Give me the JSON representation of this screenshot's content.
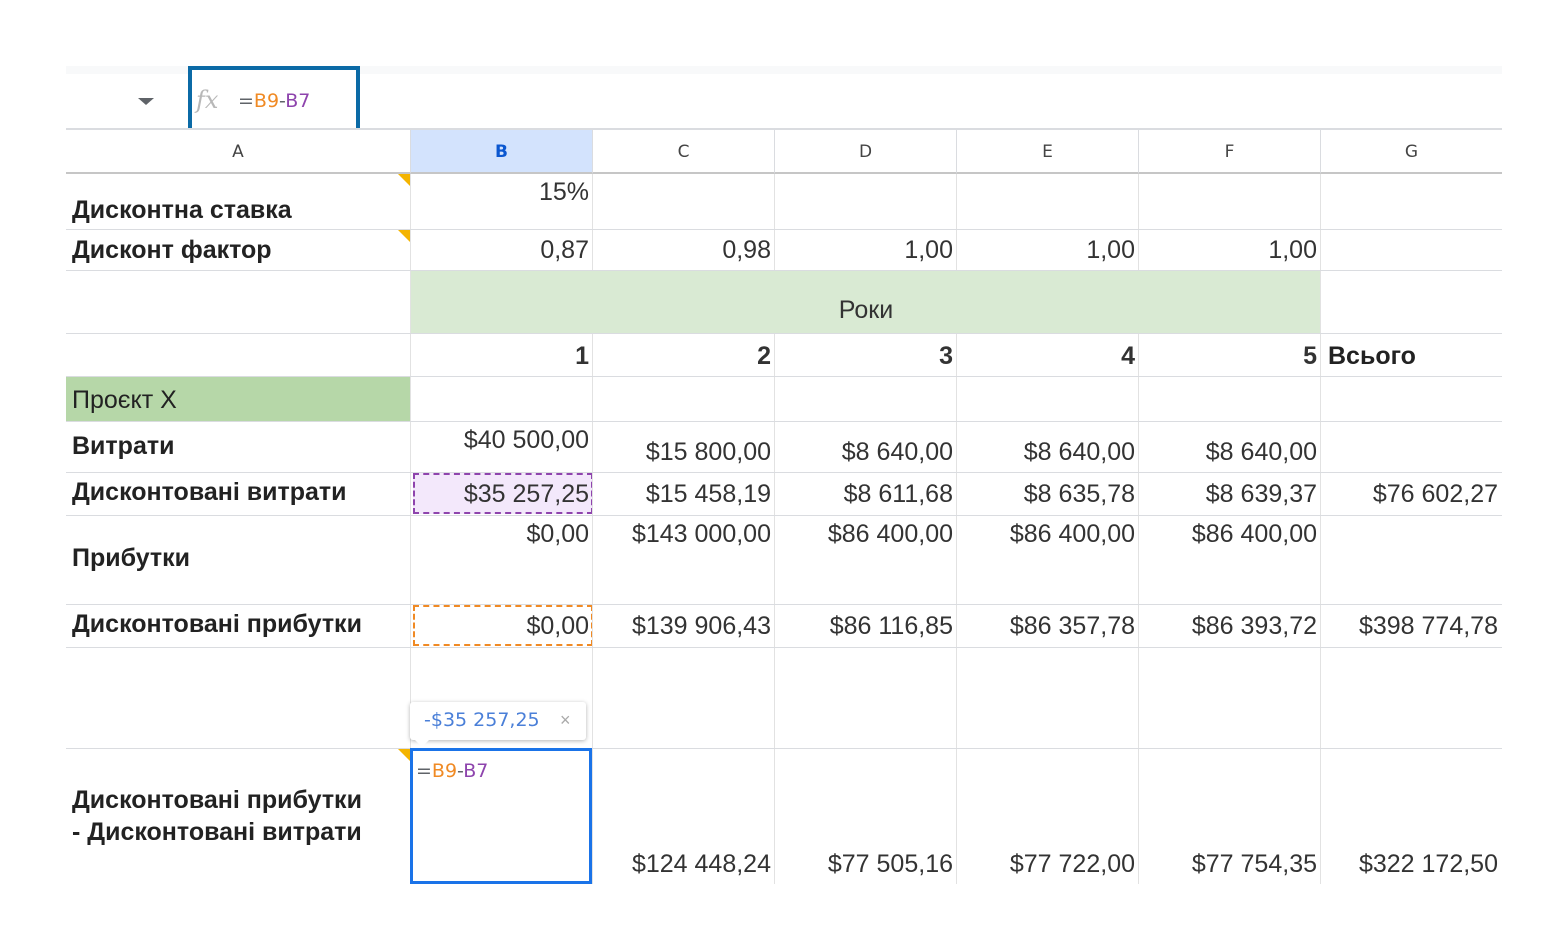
{
  "formula_bar": {
    "fx_label": "fx",
    "formula_eq": "=",
    "formula_ref1": "B9",
    "formula_op": "-",
    "formula_ref2": "B7"
  },
  "columns": [
    "A",
    "B",
    "C",
    "D",
    "E",
    "F",
    "G"
  ],
  "selected_column": "B",
  "rows": {
    "discount_rate": {
      "label": "Дисконтна ставка",
      "B": "15%"
    },
    "discount_factor": {
      "label": "Дисконт фактор",
      "B": "0,87",
      "C": "0,98",
      "D": "1,00",
      "E": "1,00",
      "F": "1,00"
    },
    "years_header": {
      "label": "Роки"
    },
    "year_numbers": {
      "B": "1",
      "C": "2",
      "D": "3",
      "E": "4",
      "F": "5",
      "G": "Всього"
    },
    "project": {
      "label": "Проєкт X"
    },
    "costs": {
      "label": "Витрати",
      "B": "$40 500,00",
      "C": "$15 800,00",
      "D": "$8 640,00",
      "E": "$8 640,00",
      "F": "$8 640,00"
    },
    "discounted_costs": {
      "label": "Дисконтовані витрати",
      "B": "$35 257,25",
      "C": "$15 458,19",
      "D": "$8 611,68",
      "E": "$8 635,78",
      "F": "$8 639,37",
      "G": "$76 602,27"
    },
    "revenues": {
      "label": "Прибутки",
      "B": "$0,00",
      "C": "$143 000,00",
      "D": "$86 400,00",
      "E": "$86 400,00",
      "F": "$86 400,00"
    },
    "discounted_revenues": {
      "label": "Дисконтовані прибутки",
      "B": "$0,00",
      "C": "$139 906,43",
      "D": "$86 116,85",
      "E": "$86 357,78",
      "F": "$86 393,72",
      "G": "$398 774,78"
    },
    "net": {
      "label_line1": "Дисконтовані прибутки",
      "label_line2": "- Дисконтовані витрати",
      "C": "$124 448,24",
      "D": "$77 505,16",
      "E": "$77 722,00",
      "F": "$77 754,35",
      "G": "$322 172,50"
    }
  },
  "edit_cell": {
    "eq": "=",
    "ref1": "B9",
    "op": "-",
    "ref2": "B7"
  },
  "tooltip": {
    "value": "-$35 257,25",
    "close": "×"
  }
}
